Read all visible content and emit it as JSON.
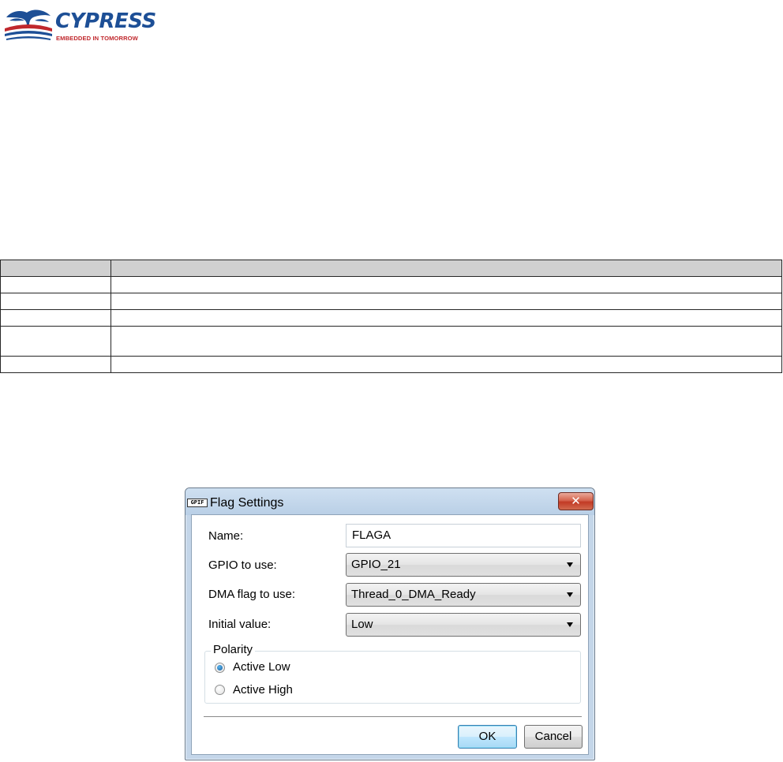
{
  "logo": {
    "wordmark": "CYPRESS",
    "tagline": "EMBEDDED IN TOMORROW",
    "colors": {
      "blue": "#1d4f96",
      "red": "#c0282d"
    }
  },
  "table": {
    "rows": 6,
    "header_bg": "#d0d0d0"
  },
  "dialog": {
    "app_icon_text": "GPIF",
    "title": "Flag Settings",
    "close_glyph": "✕",
    "fields": {
      "name_label": "Name:",
      "name_value": "FLAGA",
      "gpio_label": "GPIO to use:",
      "gpio_value": "GPIO_21",
      "dma_label": "DMA flag to use:",
      "dma_value": "Thread_0_DMA_Ready",
      "initial_label": "Initial value:",
      "initial_value": "Low"
    },
    "polarity": {
      "title": "Polarity",
      "options": [
        {
          "label": "Active Low",
          "checked": true
        },
        {
          "label": "Active High",
          "checked": false
        }
      ]
    },
    "buttons": {
      "ok": "OK",
      "cancel": "Cancel"
    }
  }
}
